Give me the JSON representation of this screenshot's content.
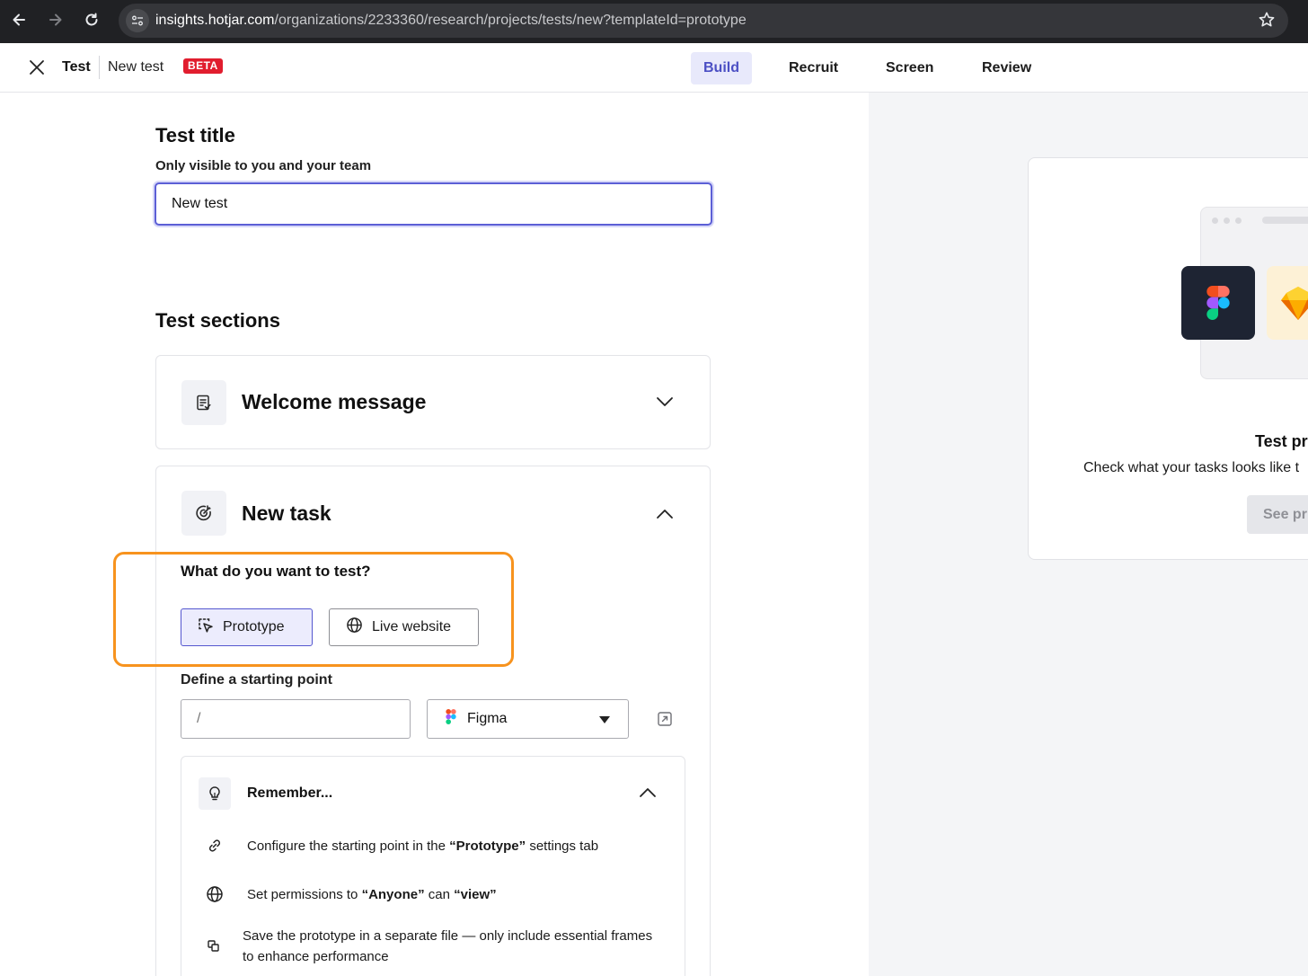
{
  "browser": {
    "url_host": "insights.hotjar.com",
    "url_path": "/organizations/2233360/research/projects/tests/new?templateId=prototype"
  },
  "header": {
    "crumb_root": "Test",
    "crumb_name": "New test",
    "badge": "BETA",
    "tabs": [
      {
        "label": "Build",
        "active": true
      },
      {
        "label": "Recruit",
        "active": false
      },
      {
        "label": "Screen",
        "active": false
      },
      {
        "label": "Review",
        "active": false
      }
    ]
  },
  "form": {
    "title_heading": "Test title",
    "title_hint": "Only visible to you and your team",
    "title_value": "New test",
    "sections_heading": "Test sections"
  },
  "sections": {
    "welcome": {
      "title": "Welcome message",
      "icon": "checklist-icon",
      "expanded": false
    },
    "task": {
      "title": "New task",
      "icon": "target-icon",
      "expanded": true
    }
  },
  "task": {
    "question": "What do you want to test?",
    "options": [
      {
        "label": "Prototype",
        "icon": "cursor-select-icon",
        "selected": true
      },
      {
        "label": "Live website",
        "icon": "globe-icon",
        "selected": false
      }
    ],
    "start_label": "Define a starting point",
    "start_placeholder": "/",
    "tool_value": "Figma"
  },
  "remember": {
    "title": "Remember...",
    "items": [
      {
        "icon": "link-icon",
        "pre": "Configure the starting point in the ",
        "bold": "“Prototype”",
        "post": " settings tab"
      },
      {
        "icon": "globe-icon",
        "pre": "Set permissions to ",
        "bold": "“Anyone”",
        "mid": " can ",
        "bold2": "“view”"
      },
      {
        "icon": "copy-icon",
        "line1": "Save the prototype in a separate file — only include essential frames",
        "line2": "to enhance performance"
      }
    ]
  },
  "preview": {
    "title": "Test pr",
    "subtitle": "Check what your tasks looks like t",
    "button": "See pr"
  },
  "colors": {
    "accent": "#5c5fd6",
    "highlight": "#f7931e",
    "badge": "#e11d2e"
  }
}
